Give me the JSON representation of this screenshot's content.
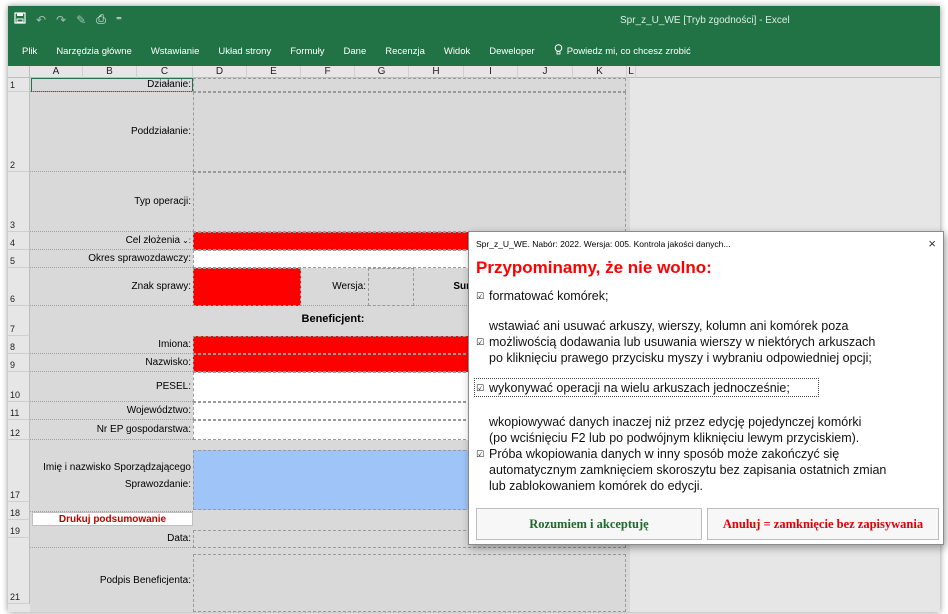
{
  "window": {
    "title": "Spr_z_U_WE  [Tryb zgodności]  -  Excel",
    "accent": "#217346"
  },
  "ribbon": {
    "tabs": [
      "Plik",
      "Narzędzia główne",
      "Wstawianie",
      "Układ strony",
      "Formuły",
      "Dane",
      "Recenzja",
      "Widok",
      "Deweloper"
    ],
    "tell_me": "Powiedz mi, co chcesz zrobić"
  },
  "columns": [
    "A",
    "B",
    "C",
    "D",
    "E",
    "F",
    "G",
    "H",
    "I",
    "J",
    "K",
    "L"
  ],
  "rows": [
    "1",
    "2",
    "3",
    "4",
    "5",
    "6",
    "7",
    "8",
    "9",
    "10",
    "11",
    "12",
    "17",
    "18",
    "19",
    "21"
  ],
  "form": {
    "dzialanie": "Działanie:",
    "poddzialanie": "Poddziałanie:",
    "typ_operacji": "Typ operacji:",
    "cel_zlozenia": "Cel złożenia",
    "okres": "Okres sprawozdawczy:",
    "znak_sprawy": "Znak sprawy:",
    "wersja": "Wersja:",
    "suma": "Suma ko",
    "beneficjent": "Beneficjent:",
    "imiona": "Imiona:",
    "nazwisko": "Nazwisko:",
    "pesel": "PESEL:",
    "wojewodztwo": "Województwo:",
    "nr_ep": "Nr EP gospodarstwa:",
    "sporzadzajacy_1": "Imię i nazwisko Sporządzającego",
    "sporzadzajacy_2": "Sprawozdanie:",
    "drukuj": "Drukuj podsumowanie",
    "data": "Data:",
    "podpis": "Podpis Beneficjenta:"
  },
  "dialog": {
    "title": "Spr_z_U_WE. Nabór: 2022. Wersja: 005. Kontrola jakości danych...",
    "close": "×",
    "heading": "Przypominamy, że nie wolno:",
    "rules": [
      "formatować komórek;",
      "wstawiać ani usuwać arkuszy, wierszy, kolumn ani komórek poza",
      "możliwością dodawania lub usuwania wierszy w niektórych arkuszach",
      "po kliknięciu prawego przycisku myszy i wybraniu odpowiedniej opcji;",
      "wykonywać operacji na wielu arkuszach jednocześnie;",
      "wkopiowywać danych inaczej niż przez edycję pojedynczej komórki",
      "(po wciśnięciu F2 lub po podwójnym kliknięciu lewym przyciskiem).",
      "Próba wkopiowania danych w inny sposób może zakończyć się",
      "automatycznym zamknięciem skoroszytu bez zapisania ostatnich zmian",
      "lub zablokowaniem komórek do edycji."
    ],
    "accept": "Rozumiem i akceptuję",
    "cancel": "Anuluj = zamknięcie bez zapisywania"
  }
}
